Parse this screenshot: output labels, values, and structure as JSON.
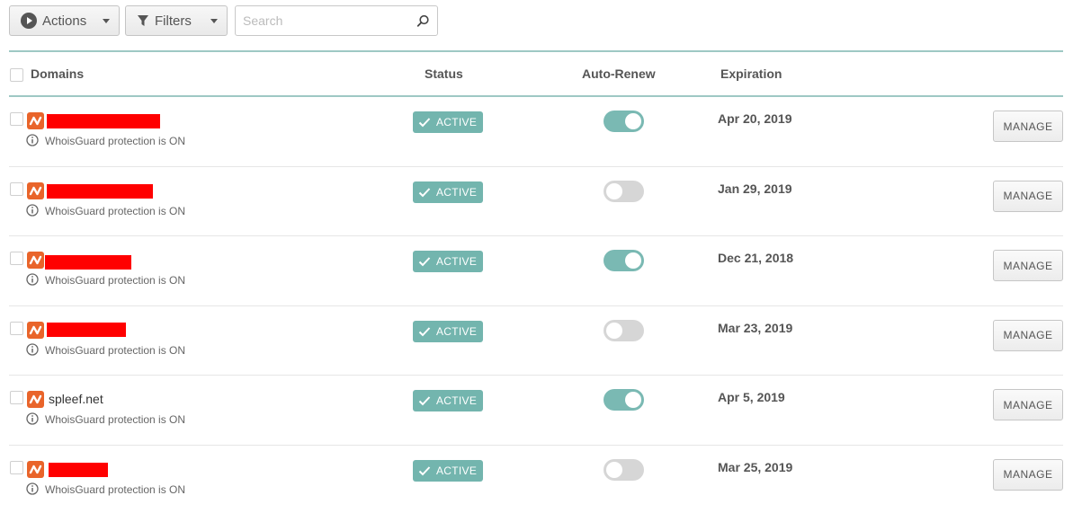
{
  "toolbar": {
    "actions_label": "Actions",
    "filters_label": "Filters",
    "search_placeholder": "Search"
  },
  "table": {
    "headers": {
      "domains": "Domains",
      "status": "Status",
      "auto_renew": "Auto-Renew",
      "expiration": "Expiration"
    },
    "rows": [
      {
        "domain": "",
        "redacted": true,
        "protection": "WhoisGuard protection is ON",
        "status": "ACTIVE",
        "auto_renew": true,
        "expiration": "Apr 20, 2019",
        "action": "MANAGE"
      },
      {
        "domain": "",
        "redacted": true,
        "protection": "WhoisGuard protection is ON",
        "status": "ACTIVE",
        "auto_renew": false,
        "expiration": "Jan 29, 2019",
        "action": "MANAGE"
      },
      {
        "domain": "",
        "redacted": true,
        "protection": "WhoisGuard protection is ON",
        "status": "ACTIVE",
        "auto_renew": true,
        "expiration": "Dec 21, 2018",
        "action": "MANAGE"
      },
      {
        "domain": "",
        "redacted": true,
        "protection": "WhoisGuard protection is ON",
        "status": "ACTIVE",
        "auto_renew": false,
        "expiration": "Mar 23, 2019",
        "action": "MANAGE"
      },
      {
        "domain": "spleef.net",
        "redacted": false,
        "protection": "WhoisGuard protection is ON",
        "status": "ACTIVE",
        "auto_renew": true,
        "expiration": "Apr 5, 2019",
        "action": "MANAGE"
      },
      {
        "domain": "",
        "redacted": true,
        "protection": "WhoisGuard protection is ON",
        "status": "ACTIVE",
        "auto_renew": false,
        "expiration": "Mar 25, 2019",
        "action": "MANAGE"
      }
    ]
  },
  "colors": {
    "accent_teal": "#73b5ae",
    "brand_orange": "#e9642a",
    "redaction_red": "#ff0000"
  },
  "icons": {
    "actions": "play-circle-icon",
    "filters": "funnel-icon",
    "search": "search-icon",
    "brand": "namecheap-logo-icon",
    "info": "info-circle-icon",
    "status": "check-icon"
  }
}
